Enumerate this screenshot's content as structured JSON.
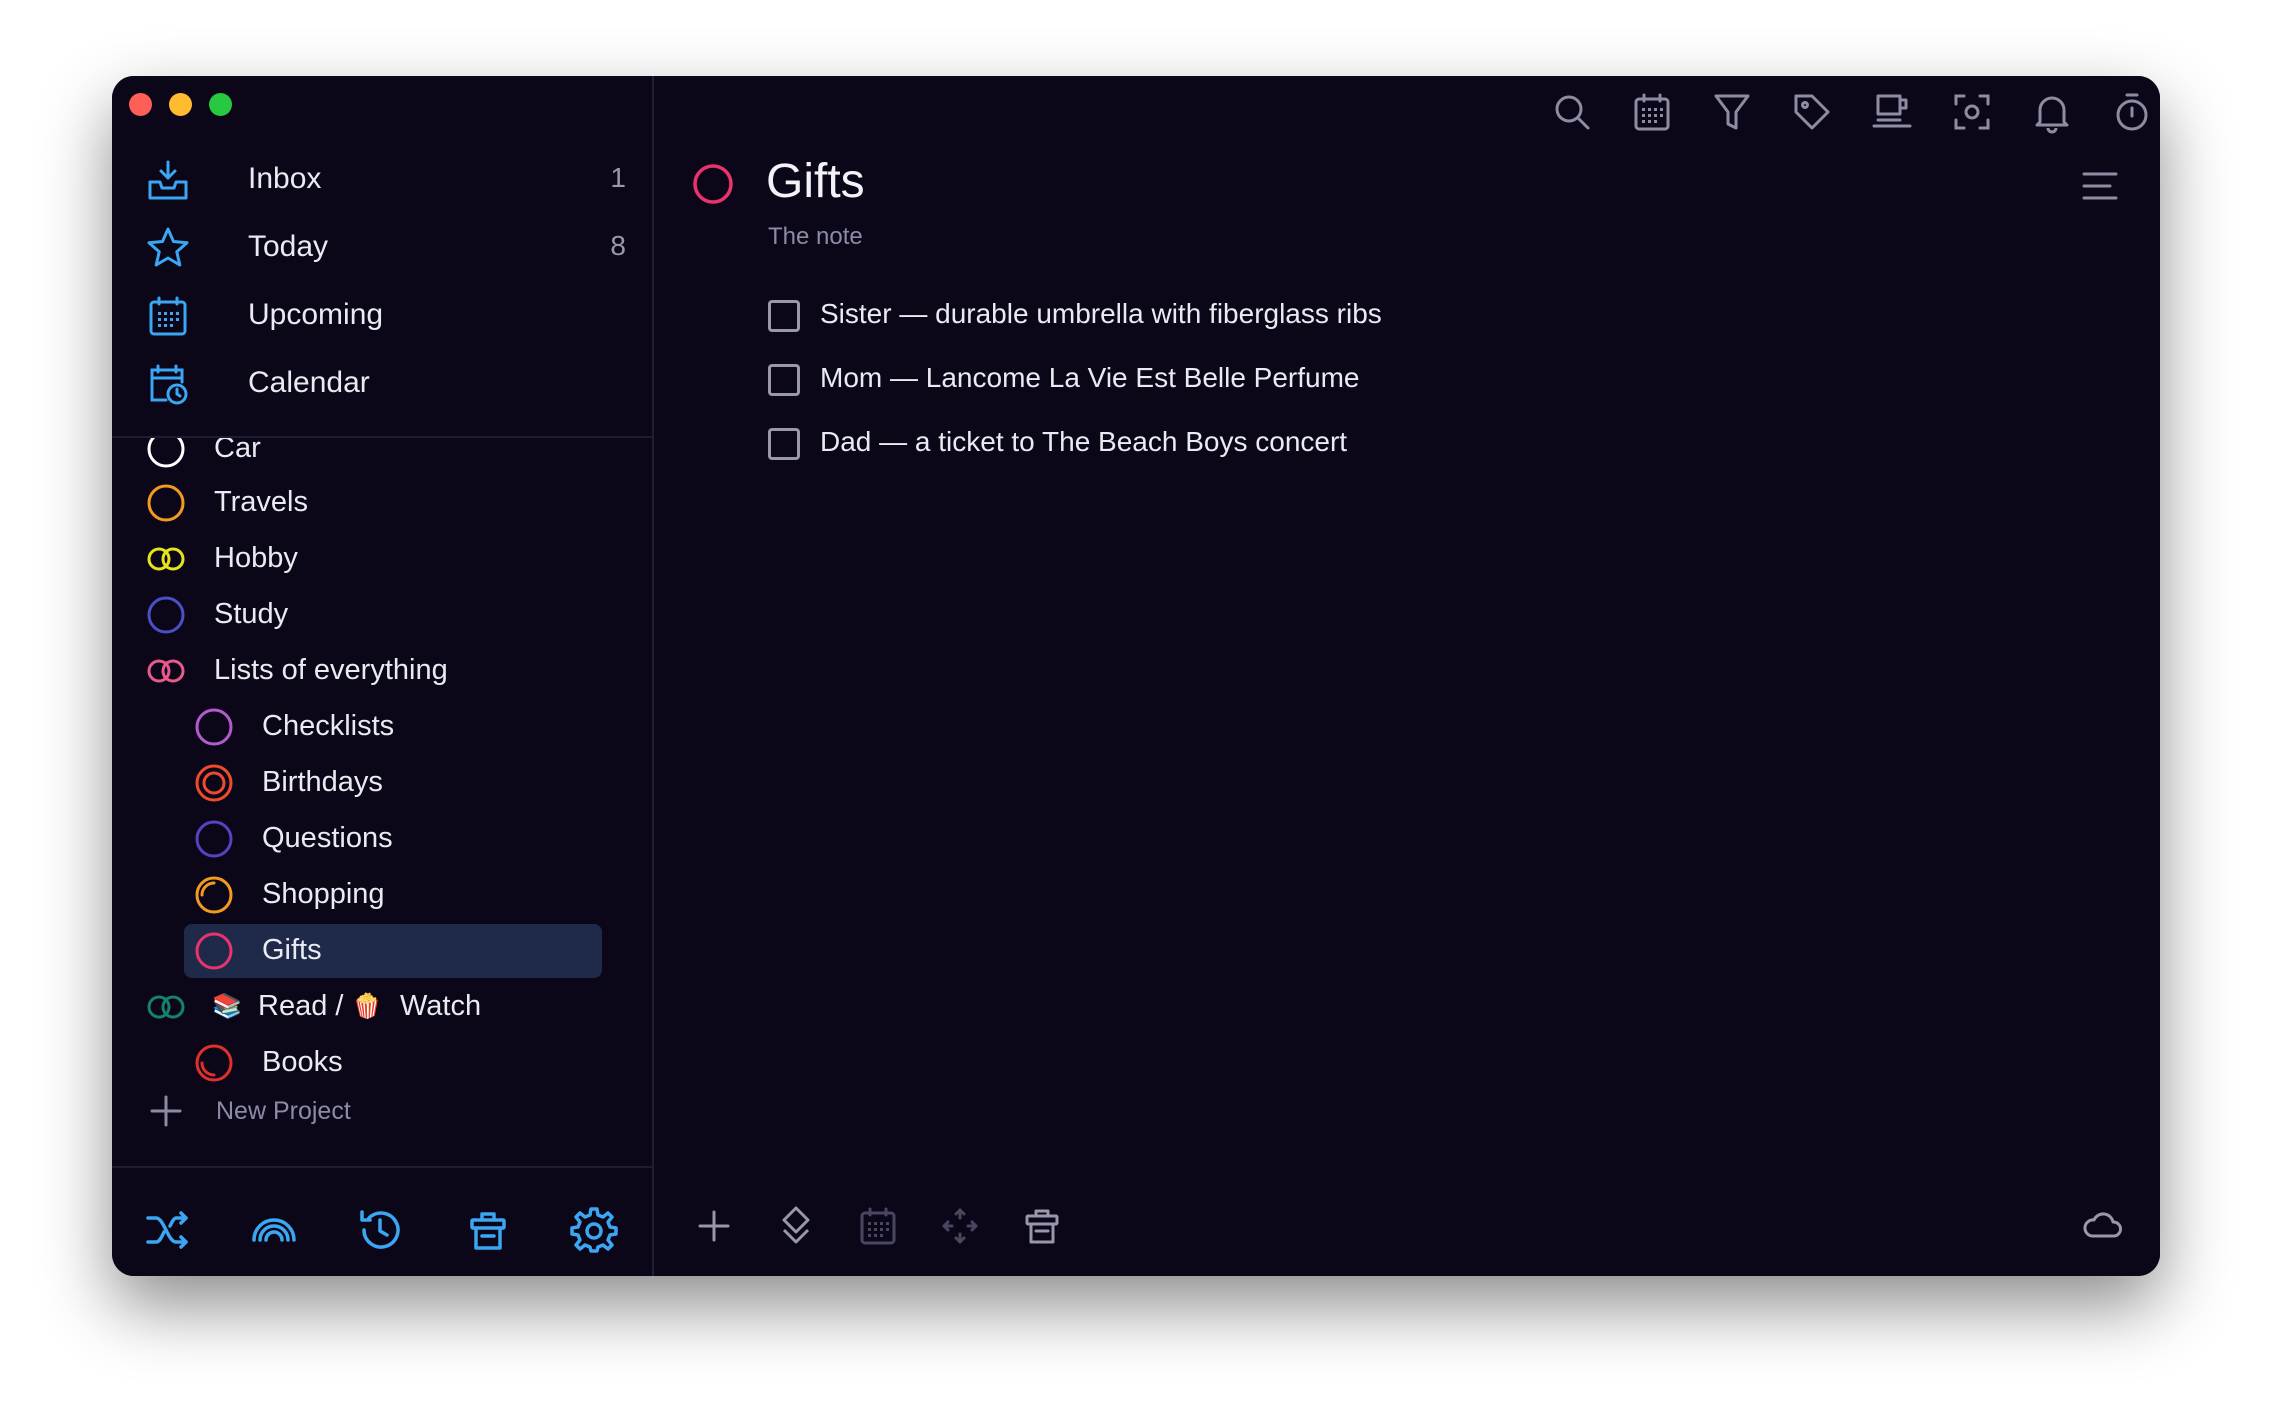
{
  "colors": {
    "window_bg": "#0b0719",
    "accent_blue": "#3ba6f2",
    "selected_bg": "#1f2a4a",
    "gifts_pink": "#e8336f",
    "text": "#eaeaf2",
    "muted": "#8e8aa6"
  },
  "nav": [
    {
      "label": "Inbox",
      "count": "1",
      "icon": "inbox-tray-icon"
    },
    {
      "label": "Today",
      "count": "8",
      "icon": "star-icon"
    },
    {
      "label": "Upcoming",
      "count": "",
      "icon": "calendar-grid-icon"
    },
    {
      "label": "Calendar",
      "count": "",
      "icon": "calendar-clock-icon"
    }
  ],
  "projects": [
    {
      "label": "Car",
      "icon": "white-circle-icon"
    },
    {
      "label": "Travels",
      "icon": "orange-circle-icon"
    },
    {
      "label": "Hobby",
      "icon": "yellow-linked-circles-icon"
    },
    {
      "label": "Study",
      "icon": "indigo-circle-icon"
    },
    {
      "label": "Lists of everything",
      "icon": "pink-linked-circles-icon"
    },
    {
      "label": "Checklists",
      "icon": "purple-circle-icon"
    },
    {
      "label": "Birthdays",
      "icon": "red-double-circle-icon"
    },
    {
      "label": "Questions",
      "icon": "violet-circle-icon"
    },
    {
      "label": "Shopping",
      "icon": "orange-partial-circle-icon"
    },
    {
      "label": "Gifts",
      "icon": "pink-circle-icon",
      "selected": true
    },
    {
      "label_a": "Read /",
      "label_b": "Watch",
      "icon": "teal-linked-circles-icon",
      "emoji_a": "📚",
      "emoji_b": "🍿"
    },
    {
      "label": "Books",
      "icon": "red-partial-circle-icon"
    }
  ],
  "new_project": {
    "label": "New Project",
    "icon": "plus-icon"
  },
  "sidebar_footer": [
    "shuffle-icon",
    "rainbow-icon",
    "history-icon",
    "trash-icon",
    "gear-icon"
  ],
  "toolbar": [
    "search-icon",
    "calendar-icon",
    "filter-icon",
    "tag-icon",
    "coffee-icon",
    "focus-icon",
    "bell-icon",
    "timer-icon",
    "duplicate-icon"
  ],
  "main": {
    "title": "Gifts",
    "note": "The note",
    "tasks": [
      {
        "label": "Sister — durable umbrella with fiberglass ribs",
        "done": false
      },
      {
        "label": "Mom — Lancome La Vie Est Belle Perfume",
        "done": false
      },
      {
        "label": "Dad — a ticket to The Beach Boys concert",
        "done": false
      }
    ]
  },
  "bottom_toolbar": [
    "add-icon",
    "priority-icon",
    "calendar-icon",
    "move-icon",
    "trash-icon"
  ],
  "sync_icon": "cloud-icon"
}
